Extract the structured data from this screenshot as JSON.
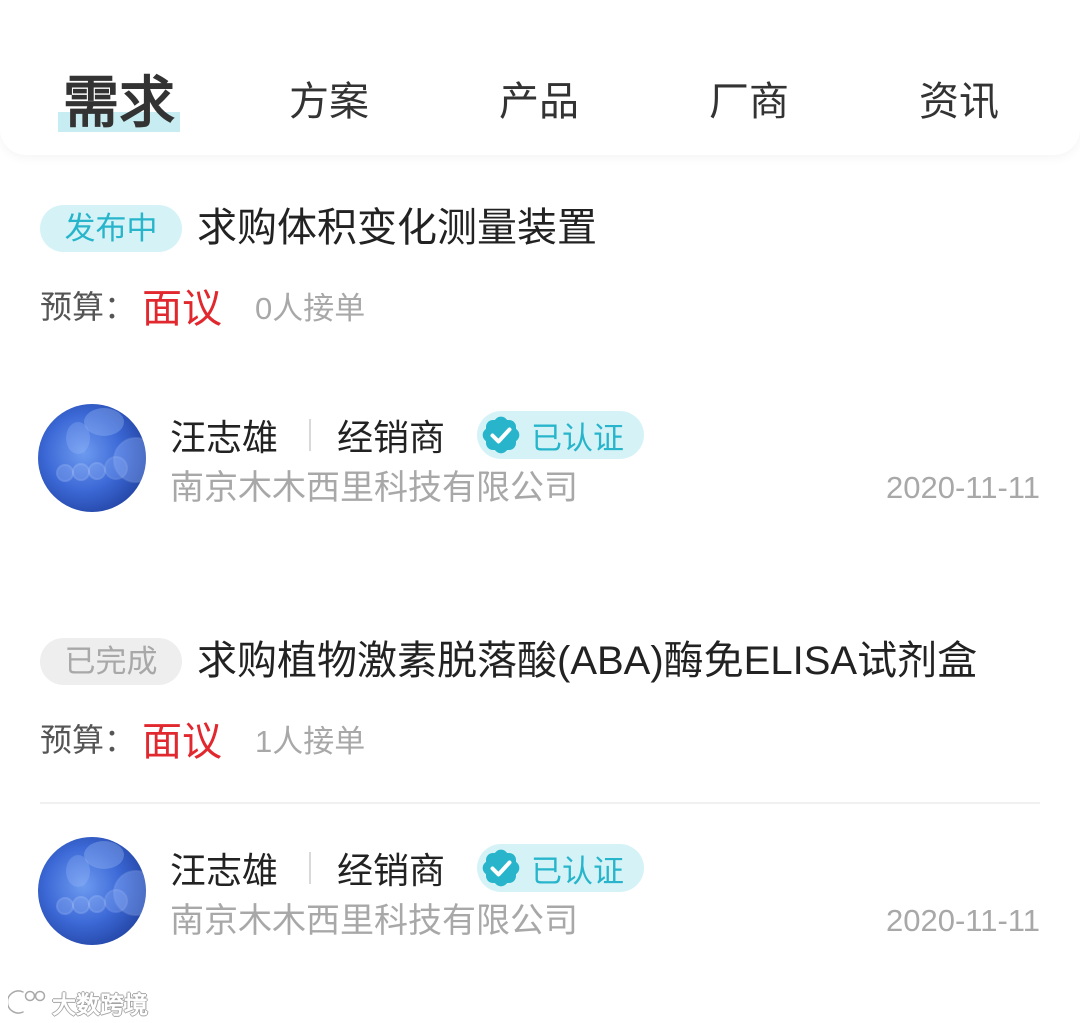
{
  "theme": {
    "accent": "#28b5cb",
    "accent_light": "#d5f3f7",
    "tab_indicator": "#c7edf2",
    "price": "#e0282e",
    "text_primary": "#222222",
    "text_secondary": "#555555",
    "text_muted": "#a8a8a8",
    "done_badge_bg": "#eeeeee",
    "done_badge_text": "#a8a8a8"
  },
  "tabs": [
    {
      "label": "需求",
      "active": true
    },
    {
      "label": "方案",
      "active": false
    },
    {
      "label": "产品",
      "active": false
    },
    {
      "label": "厂商",
      "active": false
    },
    {
      "label": "资讯",
      "active": false
    }
  ],
  "items": [
    {
      "status": "发布中",
      "status_active": true,
      "title": "求购体积变化测量装置",
      "budget_label": "预算：",
      "budget_value": "面议",
      "orders": "0人接单",
      "publisher": {
        "name": "汪志雄",
        "role": "经销商",
        "verified": "已认证",
        "company": "南京木木西里科技有限公司"
      },
      "date": "2020-11-11"
    },
    {
      "status": "已完成",
      "status_active": false,
      "title": "求购植物激素脱落酸(ABA)酶免ELISA试剂盒",
      "budget_label": "预算：",
      "budget_value": "面议",
      "orders": "1人接单",
      "publisher": {
        "name": "汪志雄",
        "role": "经销商",
        "verified": "已认证",
        "company": "南京木木西里科技有限公司"
      },
      "date": "2020-11-11"
    }
  ],
  "icons": {
    "verified": "verified-check-icon",
    "watermark_logo": "dashu-logo-icon"
  },
  "watermark": "大数跨境"
}
